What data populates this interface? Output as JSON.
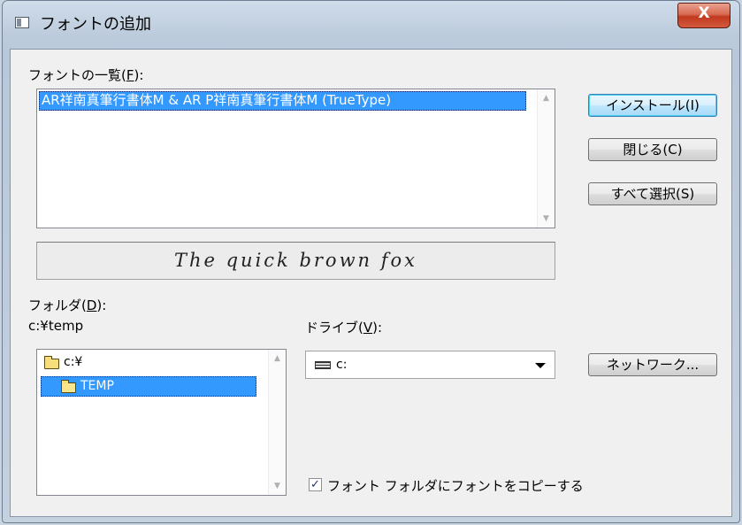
{
  "window": {
    "title": "フォントの追加",
    "close_glyph": "X"
  },
  "fonts": {
    "label": "フォントの一覧(",
    "accel": "F",
    "label_end": "):",
    "items": [
      "AR祥南真筆行書体M & AR P祥南真筆行書体M (TrueType)"
    ]
  },
  "buttons": {
    "install": "インストール(I)",
    "close": "閉じる(C)",
    "select_all": "すべて選択(S)",
    "network": "ネットワーク..."
  },
  "preview": {
    "text": "The quick brown fox"
  },
  "folders": {
    "label": "フォルダ(",
    "accel": "D",
    "label_end": "):",
    "current_path": "c:¥temp",
    "items": [
      {
        "label": "c:¥",
        "icon": "folder-icon"
      },
      {
        "label": "TEMP",
        "icon": "open-folder-icon"
      }
    ]
  },
  "drives": {
    "label": "ドライブ(",
    "accel": "V",
    "label_end": "):",
    "selected": "c:",
    "icon": "drive-icon"
  },
  "copy_option": {
    "label": "フォント フォルダにフォントをコピーする",
    "checked": true
  },
  "colors": {
    "selection": "#3399ff",
    "dialog_bg": "#f0f0f0",
    "close_button": "#c9442a"
  }
}
